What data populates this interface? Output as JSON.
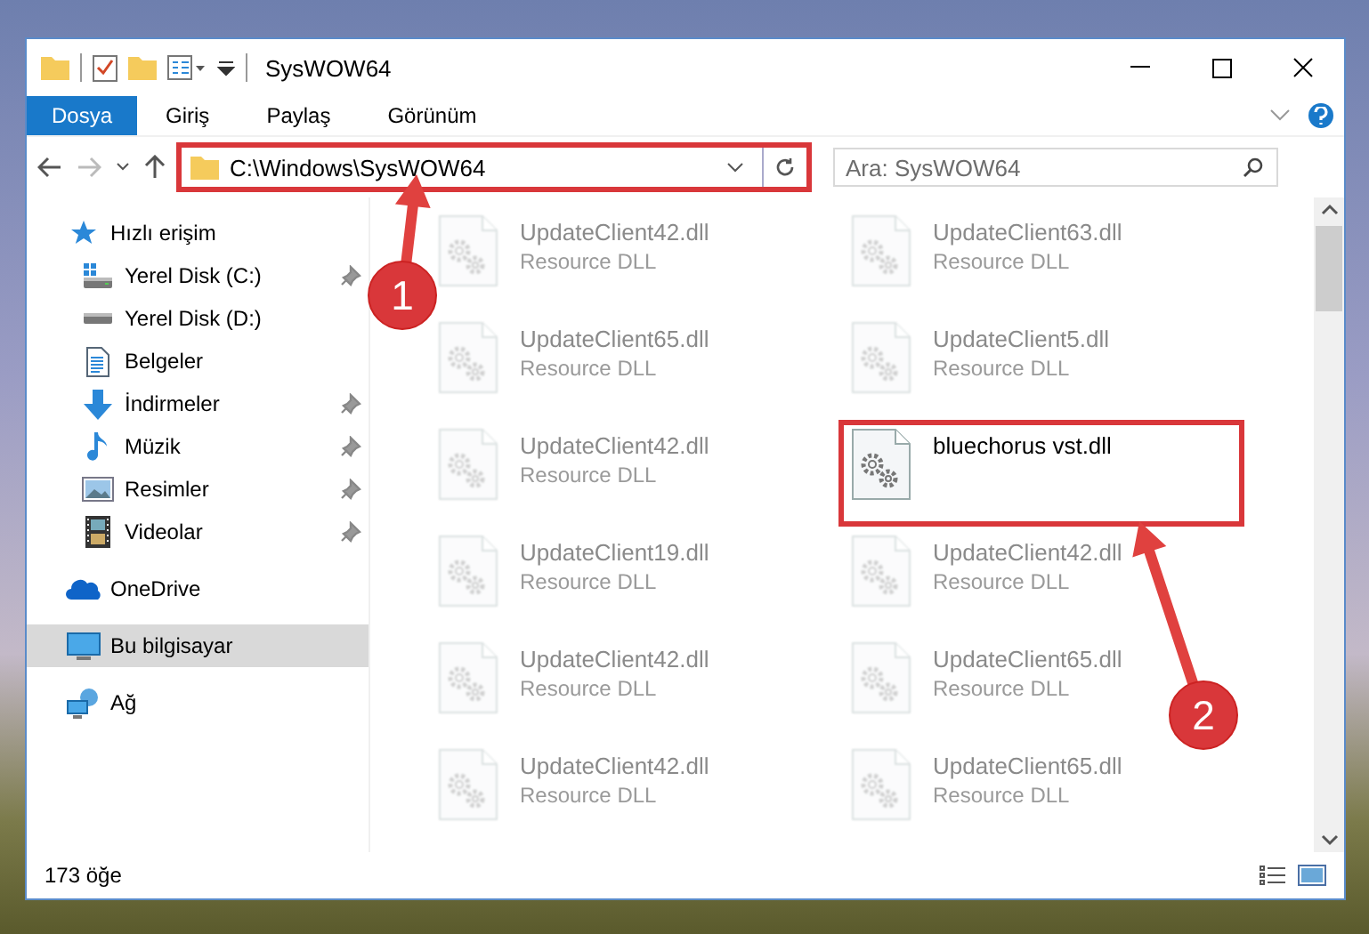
{
  "window": {
    "title": "SysWOW64"
  },
  "ribbon_tabs": [
    {
      "label": "Dosya",
      "kind": "file"
    },
    {
      "label": "Giriş",
      "kind": "tab"
    },
    {
      "label": "Paylaş",
      "kind": "tab"
    },
    {
      "label": "Görünüm",
      "kind": "tab"
    }
  ],
  "address_bar": {
    "path": "C:\\Windows\\SysWOW64",
    "highlighted": true
  },
  "search": {
    "placeholder": "Ara: SysWOW64"
  },
  "nav": [
    {
      "label": "Hızlı erişim",
      "kind": "star",
      "selected": false,
      "children": [
        {
          "label": "Yerel Disk (C:)",
          "kind": "system-drive",
          "pinned": true,
          "selected": false
        },
        {
          "label": "Yerel Disk (D:)",
          "kind": "drive",
          "pinned": false,
          "selected": false
        },
        {
          "label": "Belgeler",
          "kind": "documents",
          "pinned": false,
          "selected": false
        },
        {
          "label": "İndirmeler",
          "kind": "download",
          "pinned": true,
          "selected": false
        },
        {
          "label": "Müzik",
          "kind": "music",
          "pinned": true,
          "selected": false
        },
        {
          "label": "Resimler",
          "kind": "pictures",
          "pinned": true,
          "selected": false
        },
        {
          "label": "Videolar",
          "kind": "video",
          "pinned": true,
          "selected": false
        }
      ]
    },
    {
      "label": "OneDrive",
      "kind": "cloud",
      "selected": false
    },
    {
      "label": "Bu bilgisayar",
      "kind": "computer",
      "selected": true
    },
    {
      "label": "Ağ",
      "kind": "network",
      "selected": false
    }
  ],
  "files": [
    {
      "name": "UpdateClient42.dll",
      "type": "Resource DLL",
      "faded": true,
      "highlighted": false
    },
    {
      "name": "UpdateClient63.dll",
      "type": "Resource DLL",
      "faded": true,
      "highlighted": false
    },
    {
      "name": "UpdateClient65.dll",
      "type": "Resource DLL",
      "faded": true,
      "highlighted": false
    },
    {
      "name": "UpdateClient5.dll",
      "type": "Resource DLL",
      "faded": true,
      "highlighted": false
    },
    {
      "name": "UpdateClient42.dll",
      "type": "Resource DLL",
      "faded": true,
      "highlighted": false
    },
    {
      "name": "bluechorus vst.dll",
      "faded": false,
      "highlighted": true
    },
    {
      "name": "UpdateClient19.dll",
      "type": "Resource DLL",
      "faded": true,
      "highlighted": false
    },
    {
      "name": "UpdateClient42.dll",
      "type": "Resource DLL",
      "faded": true,
      "highlighted": false
    },
    {
      "name": "UpdateClient42.dll",
      "type": "Resource DLL",
      "faded": true,
      "highlighted": false
    },
    {
      "name": "UpdateClient65.dll",
      "type": "Resource DLL",
      "faded": true,
      "highlighted": false
    },
    {
      "name": "UpdateClient42.dll",
      "type": "Resource DLL",
      "faded": true,
      "highlighted": false
    },
    {
      "name": "UpdateClient65.dll",
      "type": "Resource DLL",
      "faded": true,
      "highlighted": false
    }
  ],
  "status_bar": {
    "count": "173 öğe"
  },
  "annotations": [
    {
      "label": "1"
    },
    {
      "label": "2"
    }
  ]
}
